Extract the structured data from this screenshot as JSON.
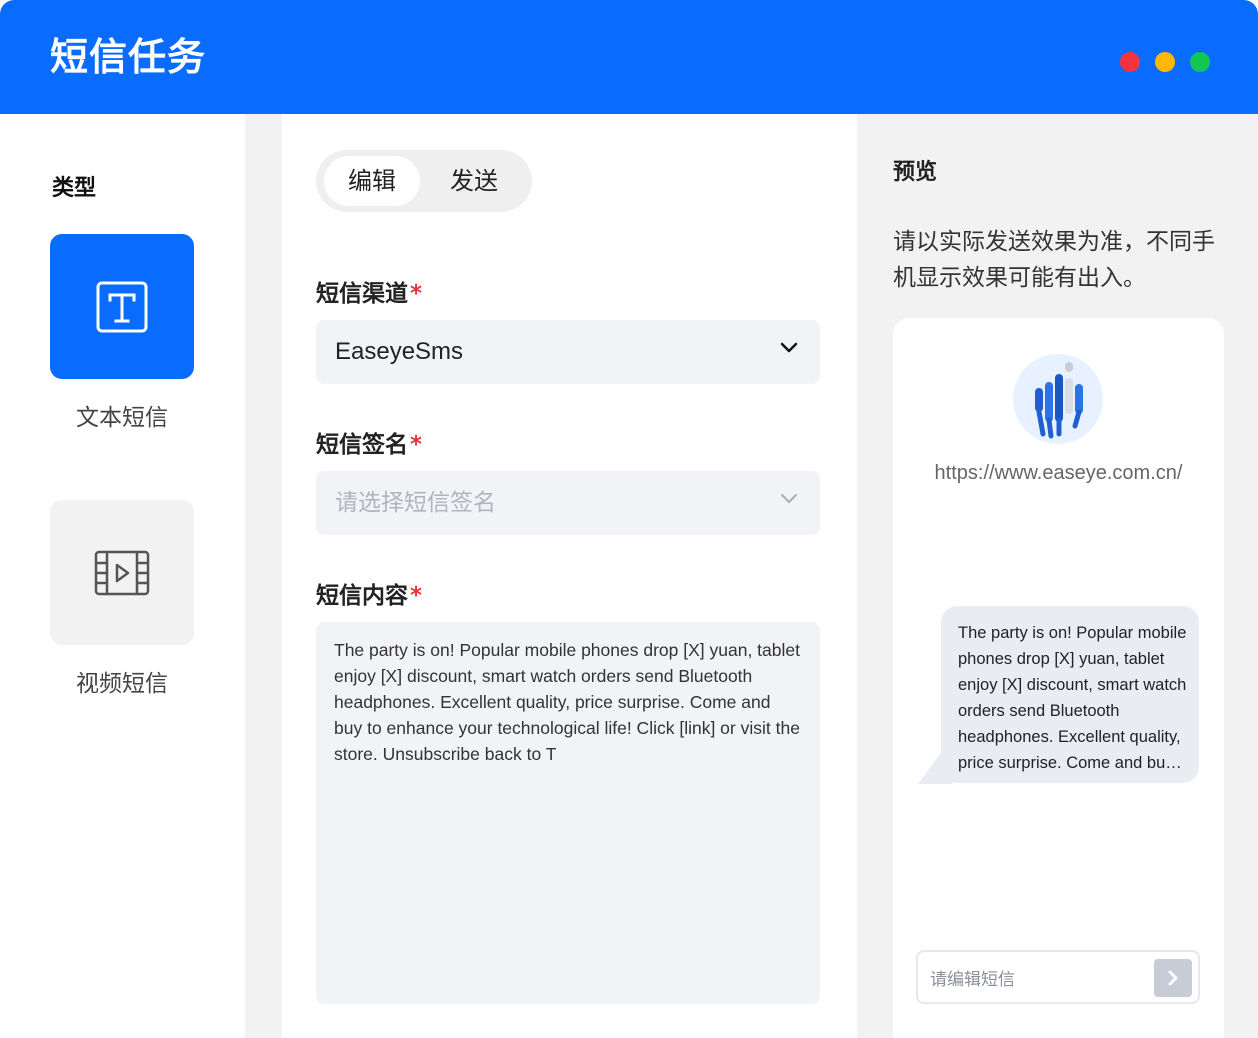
{
  "window": {
    "title": "短信任务",
    "controls": {
      "close_color": "#f5333f",
      "minimize_color": "#ffb900",
      "maximize_color": "#13c552"
    }
  },
  "sidebar": {
    "heading": "类型",
    "types": [
      {
        "label": "文本短信",
        "icon": "text-icon",
        "selected": true
      },
      {
        "label": "视频短信",
        "icon": "video-icon",
        "selected": false
      }
    ]
  },
  "form": {
    "tabs": [
      {
        "label": "编辑",
        "active": true
      },
      {
        "label": "发送",
        "active": false
      }
    ],
    "channel": {
      "label": "短信渠道",
      "required_mark": "*",
      "value": "EaseyeSms"
    },
    "signature": {
      "label": "短信签名",
      "required_mark": "*",
      "placeholder": "请选择短信签名"
    },
    "content": {
      "label": "短信内容",
      "required_mark": "*",
      "value": "The party is on! Popular mobile phones drop [X] yuan, tablet enjoy [X] discount, smart watch orders send Bluetooth headphones. Excellent quality, price surprise. Come and buy to enhance your technological life! Click [link] or visit the store. Unsubscribe back to T"
    }
  },
  "preview": {
    "heading": "预览",
    "note": "请以实际发送效果为准，不同手机显示效果可能有出入。",
    "sender_url": "https://www.easeye.com.cn/",
    "message": "The party is on! Popular mobile phones drop [X] yuan, tablet enjoy [X] discount, smart watch orders send Bluetooth headphones. Excellent quality, price surprise. Come and buy to enhance your technological life! Click [link] or visit the store. Unsubscribe back to T",
    "input_placeholder": "请编辑短信"
  },
  "colors": {
    "accent": "#0a6cff",
    "required": "#e8333b"
  }
}
